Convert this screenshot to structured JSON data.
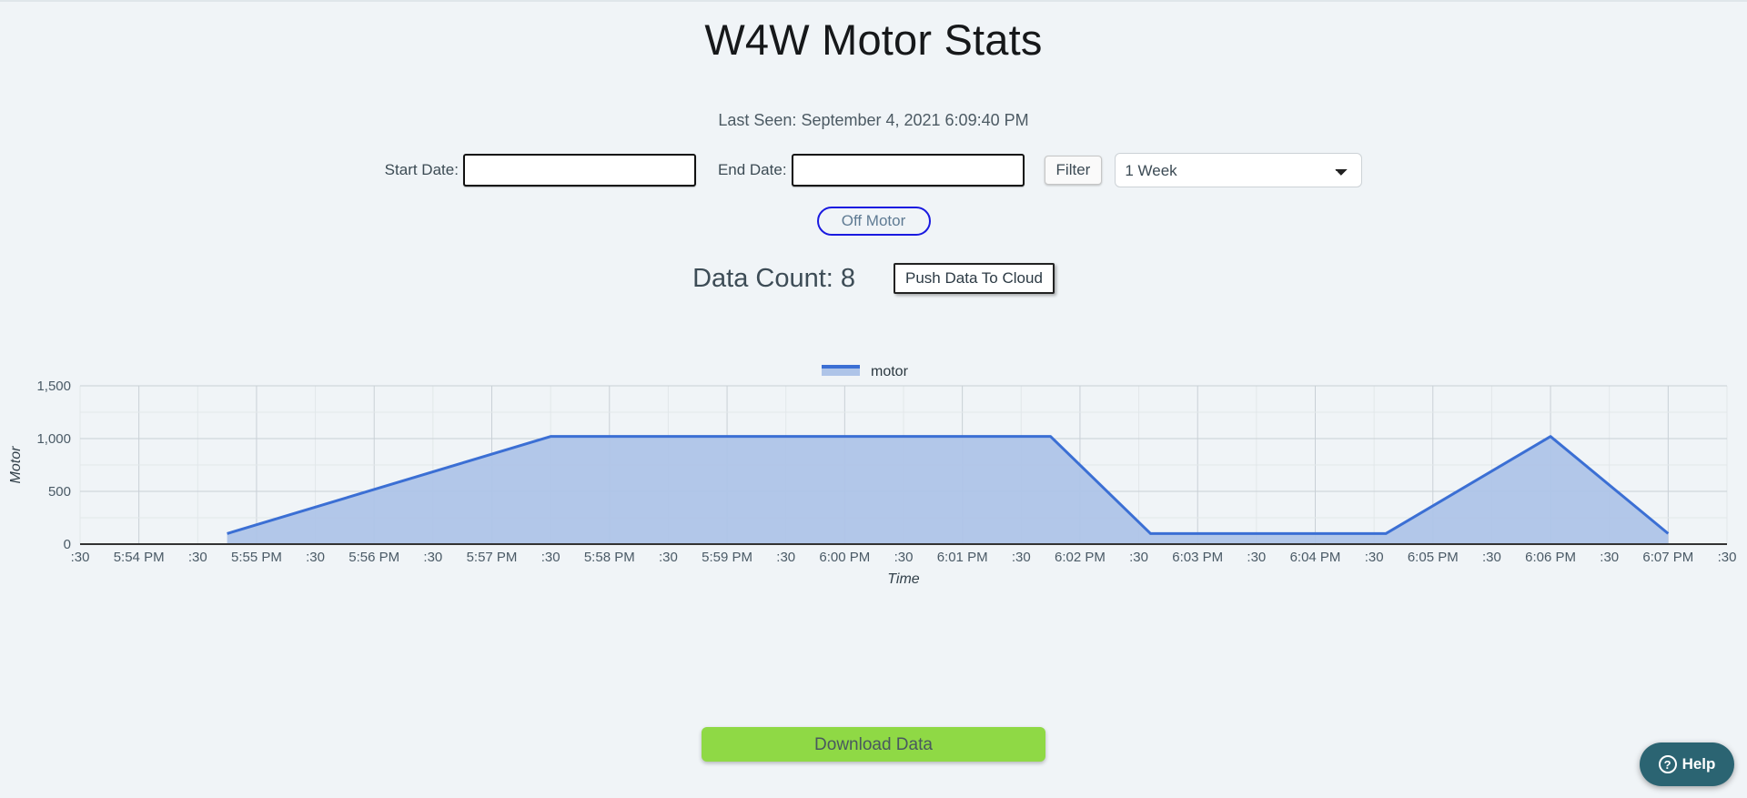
{
  "header": {
    "title": "W4W Motor Stats",
    "last_seen": "Last Seen: September 4, 2021 6:09:40 PM"
  },
  "filters": {
    "start_date_label": "Start Date:",
    "start_date_value": "",
    "start_date_placeholder": "",
    "end_date_label": "End Date:",
    "end_date_value": "",
    "end_date_placeholder": "",
    "filter_button": "Filter",
    "range_selected": "1 Week",
    "range_options": [
      "1 Week"
    ]
  },
  "motor": {
    "toggle_label": "Off Motor",
    "toggle_border_color": "#1a1ae0",
    "toggle_text_color": "#5f7b93"
  },
  "counts": {
    "data_count_label": "Data Count: 8",
    "push_button": "Push Data To Cloud"
  },
  "actions": {
    "download_label": "Download Data",
    "download_color": "#8fd945"
  },
  "help": {
    "label": "Help",
    "icon": "question-circle-icon",
    "background": "#2b6472"
  },
  "chart_data": {
    "type": "area",
    "title": "",
    "xlabel": "Time",
    "ylabel": "Motor",
    "legend": [
      {
        "name": "motor",
        "line_color": "#3b6fd4",
        "fill_color": "#aec4e8"
      }
    ],
    "legend_position": "top-center",
    "grid": true,
    "ylim": [
      0,
      1500
    ],
    "yticks": [
      0,
      500,
      1000,
      1500
    ],
    "ytick_labels": [
      "0",
      "500",
      "1,000",
      "1,500"
    ],
    "xtick_labels": [
      ":30",
      "5:54 PM",
      ":30",
      "5:55 PM",
      ":30",
      "5:56 PM",
      ":30",
      "5:57 PM",
      ":30",
      "5:58 PM",
      ":30",
      "5:59 PM",
      ":30",
      "6:00 PM",
      ":30",
      "6:01 PM",
      ":30",
      "6:02 PM",
      ":30",
      "6:03 PM",
      ":30",
      "6:04 PM",
      ":30",
      "6:05 PM",
      ":30",
      "6:06 PM",
      ":30",
      "6:07 PM",
      ":30"
    ],
    "xlim": [
      0,
      28
    ],
    "series": [
      {
        "name": "motor",
        "points": [
          {
            "x": 2.5,
            "y": 100
          },
          {
            "x": 8.0,
            "y": 1020
          },
          {
            "x": 16.5,
            "y": 1020
          },
          {
            "x": 18.2,
            "y": 100
          },
          {
            "x": 22.2,
            "y": 100
          },
          {
            "x": 25.0,
            "y": 1020
          },
          {
            "x": 27.0,
            "y": 100
          }
        ]
      }
    ]
  }
}
